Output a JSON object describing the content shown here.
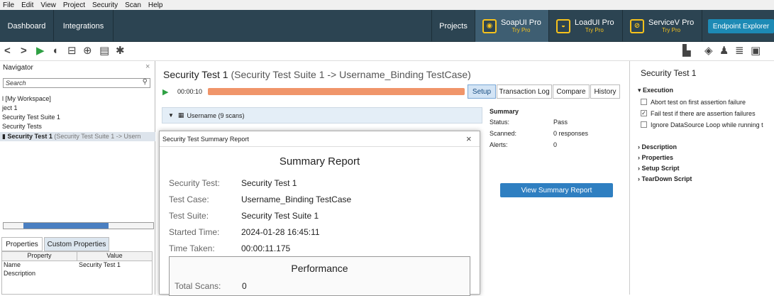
{
  "menu": [
    "File",
    "Edit",
    "View",
    "Project",
    "Security",
    "Scan",
    "Help"
  ],
  "topbar": {
    "dashboard": "Dashboard",
    "integrations": "Integrations",
    "projects": "Projects",
    "products": [
      {
        "name": "SoapUI Pro",
        "sub": "Try Pro"
      },
      {
        "name": "LoadUI Pro",
        "sub": "Try Pro"
      },
      {
        "name": "ServiceV Pro",
        "sub": "Try Pro"
      }
    ],
    "endpoint_explorer": "Endpoint Explorer"
  },
  "navigator": {
    "title": "Navigator",
    "search_placeholder": "Search",
    "tree": [
      "l [My Workspace]",
      "ject 1",
      "Security Test Suite 1",
      "Security Tests"
    ],
    "selected_item": "Security Test 1",
    "selected_suffix": "(Security Test Suite 1 -> Usern",
    "props_tabs": [
      "Properties",
      "Custom Properties"
    ],
    "props_headers": [
      "Property",
      "Value"
    ],
    "props_rows": [
      [
        "Name",
        "Security Test 1"
      ],
      [
        "Description",
        ""
      ]
    ]
  },
  "main": {
    "title": "Security Test 1",
    "title_context": "(Security Test Suite 1 -> Username_Binding TestCase)",
    "timer": "00:00:10",
    "progress": 1.0,
    "tabs": [
      "Setup",
      "Transaction Log",
      "Compare",
      "History"
    ],
    "scan_row": "Username (9 scans)",
    "summary": {
      "title": "Summary",
      "rows": [
        [
          "Status:",
          "Pass"
        ],
        [
          "Scanned:",
          "0 responses"
        ],
        [
          "Alerts:",
          "0"
        ]
      ],
      "view_button": "View Summary Report"
    }
  },
  "dialog": {
    "window_title": "Security Test Summary Report",
    "heading": "Summary Report",
    "rows": [
      [
        "Security Test:",
        "Security Test 1"
      ],
      [
        "Test Case:",
        "Username_Binding TestCase"
      ],
      [
        "Test Suite:",
        "Security Test Suite 1"
      ],
      [
        "Started Time:",
        "2024-01-28 16:45:11"
      ],
      [
        "Time Taken:",
        "00:00:11.175"
      ]
    ],
    "performance_heading": "Performance",
    "perf_rows": [
      [
        "Total Scans:",
        "0"
      ]
    ]
  },
  "right": {
    "title": "Security Test 1",
    "execution": "Execution",
    "options": [
      {
        "label": "Abort test on first assertion failure",
        "checked": false
      },
      {
        "label": "Fail test if there are assertion failures",
        "checked": true
      },
      {
        "label": "Ignore DataSource Loop while running t",
        "checked": false
      }
    ],
    "sections": [
      "Description",
      "Properties",
      "Setup Script",
      "TearDown Script"
    ]
  },
  "colors": {
    "topbar": "#2c4452",
    "progress": "#f0956a",
    "accent": "#2f7fc1",
    "pro_yellow": "#f6c21c"
  }
}
